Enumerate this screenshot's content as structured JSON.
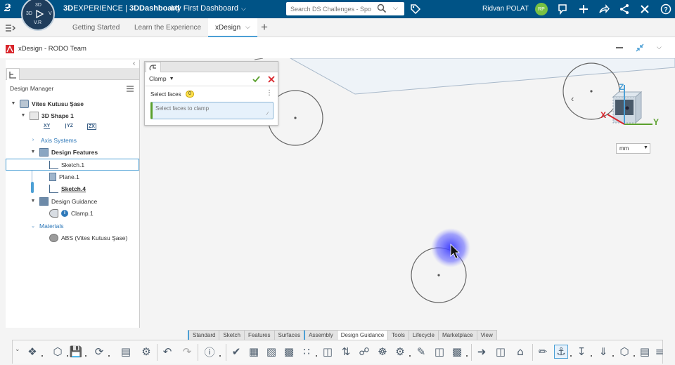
{
  "topbar": {
    "brand_bold": "3D",
    "brand_rest": "EXPERIENCE",
    "separator": "|",
    "app_name": "3DDashboard",
    "dashboard_name": "My First Dashboard",
    "search_placeholder": "Search DS Challenges - Spo",
    "user_name": "Ridvan POLAT",
    "user_initials": "RP"
  },
  "compass": {
    "label_3d": "3D",
    "label_vr": "V.R",
    "label_top": "3D",
    "label_right": "V"
  },
  "tabs": [
    {
      "label": "Getting Started"
    },
    {
      "label": "Learn the Experience"
    },
    {
      "label": "xDesign"
    }
  ],
  "app_title": "xDesign - RODO Team",
  "tree": {
    "header": "Design Manager",
    "items": [
      {
        "label": "Vites Kutusu Şase"
      },
      {
        "label": "3D Shape 1"
      },
      {
        "label": "Axis Systems"
      },
      {
        "label": "Design Features"
      },
      {
        "label": "Sketch.1"
      },
      {
        "label": "Plane.1"
      },
      {
        "label": "Sketch.4"
      },
      {
        "label": "Design Guidance"
      },
      {
        "label": "Clamp.1"
      },
      {
        "label": "Materials"
      },
      {
        "label": "ABS (Vites Kutusu Şase)"
      }
    ],
    "plane_labels": [
      "XY",
      "YZ",
      "ZX"
    ]
  },
  "clamp_panel": {
    "title": "Clamp",
    "select_label": "Select faces",
    "count": "0",
    "input_placeholder": "Select faces to clamp"
  },
  "units": {
    "selected": "mm"
  },
  "triad": {
    "x": "X",
    "y": "Y",
    "z": "Z"
  },
  "command_tabs": [
    "Standard",
    "Sketch",
    "Features",
    "Surfaces",
    "Assembly",
    "Design Guidance",
    "Tools",
    "Lifecycle",
    "Marketplace",
    "View"
  ],
  "colors": {
    "topbar": "#005386",
    "accent": "#4b9fd5",
    "confirm": "#5aa02c",
    "cancel": "#d9262c",
    "highlight": "#5a5aff"
  }
}
